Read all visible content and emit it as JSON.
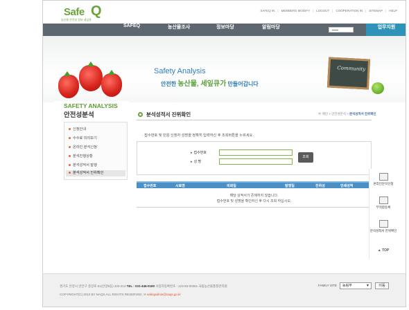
{
  "logo": {
    "word": "Safe",
    "q": "Q",
    "sub": "농산물 안전성 정보 세잎큐"
  },
  "utility": [
    "SAFEQ IN",
    "MEMBERS MODIFY",
    "LOGOUT",
    "COOPERATION IN",
    "SITEMAP",
    "HELP"
  ],
  "gnb": {
    "menus": [
      "SAFEQ",
      "농산물조사",
      "정보마당",
      "알림마당"
    ],
    "support": "업무지원"
  },
  "visual": {
    "title_en": "Safety Analysis",
    "title_ko_pre": "안전한 ",
    "title_ko_big": "농산물, 세잎큐가",
    "title_ko_post": " 만들어갑니다",
    "board": "Community"
  },
  "sidebar": {
    "title_en": "SAFETY ANALYSIS",
    "title_ko": "안전성분석",
    "items": [
      "신청안내",
      "수수료 미리보기",
      "온라인 분석신청",
      "분석진행상황",
      "분석성적서 발행",
      "분석성적서 진위확인"
    ],
    "active_index": 5
  },
  "page": {
    "title": "분석성적서 진위확인",
    "breadcrumb": [
      "메인",
      "안전성분석",
      "분석성적서 진위확인"
    ],
    "intro": "· 접수번호 및 민원 신청자 성명을 정확히 입력하신 후 조회버튼을 누르세요."
  },
  "form": {
    "receipt_label": "접수번호",
    "name_label": "성    명",
    "receipt_value": "",
    "name_value": "",
    "submit": "조회"
  },
  "table": {
    "headers": [
      "접수번호",
      "시료명",
      "의뢰일",
      "발행일",
      "진위성",
      "인쇄성적"
    ],
    "empty_line1": "해당 성적서가 존재하지 않습니다.",
    "empty_line2": "접수번호 및 성명을 확인하신 후 다시 조회 하십시오."
  },
  "quick": {
    "items": [
      "온라인분석신청",
      "부적합등록",
      "분석성적서 진위확인"
    ],
    "top": "TOP"
  },
  "footer": {
    "address_pre": "경기도 안양시 만안구 중앙로 51(안양5동) 433-213 ",
    "tel": "TEL : 031-446-0180",
    "address_post": " 사업자등록번호 : 123-83-00361 국립농산물품질관리원",
    "copyright": "COPYRIGHT(C) 2010 BY NAQS ALL RIGHTS RESERVED. ",
    "email": "safeqadmin@naqs.go.kr",
    "family_label": "FAMILY SITE",
    "family_value": "농림부",
    "go": "이동"
  },
  "colors": {
    "brand_green": "#6aa33b",
    "nav": "#5e6770",
    "accent_blue": "#2f93b8",
    "table_head": "#4a8fc5"
  }
}
